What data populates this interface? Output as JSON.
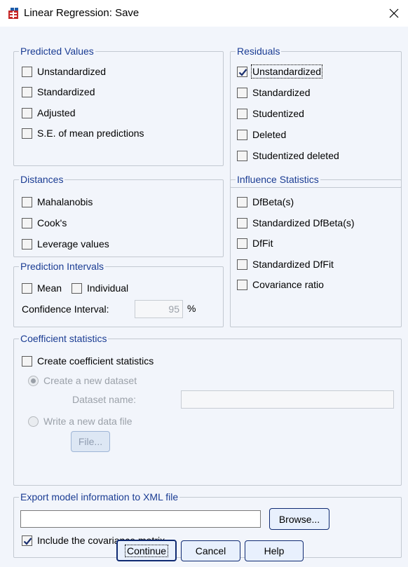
{
  "window": {
    "title": "Linear Regression: Save",
    "app_icon": "spss-dialog-icon",
    "close_icon": "close-icon"
  },
  "predicted_values": {
    "legend": "Predicted Values",
    "items": [
      {
        "label": "Unstandardized",
        "checked": false
      },
      {
        "label": "Standardized",
        "checked": false
      },
      {
        "label": "Adjusted",
        "checked": false
      },
      {
        "label": "S.E. of mean predictions",
        "checked": false
      }
    ]
  },
  "residuals": {
    "legend": "Residuals",
    "items": [
      {
        "label": "Unstandardized",
        "checked": true
      },
      {
        "label": "Standardized",
        "checked": false
      },
      {
        "label": "Studentized",
        "checked": false
      },
      {
        "label": "Deleted",
        "checked": false
      },
      {
        "label": "Studentized deleted",
        "checked": false
      }
    ]
  },
  "distances": {
    "legend": "Distances",
    "items": [
      {
        "label": "Mahalanobis",
        "checked": false
      },
      {
        "label": "Cook's",
        "checked": false
      },
      {
        "label": "Leverage values",
        "checked": false
      }
    ]
  },
  "influence": {
    "legend": "Influence Statistics",
    "items": [
      {
        "label": "DfBeta(s)",
        "checked": false
      },
      {
        "label": "Standardized DfBeta(s)",
        "checked": false
      },
      {
        "label": "DfFit",
        "checked": false
      },
      {
        "label": "Standardized DfFit",
        "checked": false
      },
      {
        "label": "Covariance ratio",
        "checked": false
      }
    ]
  },
  "prediction_intervals": {
    "legend": "Prediction Intervals",
    "mean_label": "Mean",
    "individual_label": "Individual",
    "confidence_label": "Confidence Interval:",
    "confidence_value": "95",
    "percent": "%"
  },
  "coefficient": {
    "legend": "Coefficient statistics",
    "create_label": "Create coefficient statistics",
    "new_dataset_label": "Create a new dataset",
    "dataset_name_label": "Dataset name:",
    "dataset_name_value": "",
    "write_file_label": "Write a new data file",
    "file_button": "File..."
  },
  "export": {
    "legend": "Export model information to XML file",
    "path_value": "",
    "browse_button": "Browse...",
    "include_cov_label": "Include the covariance matrix",
    "include_cov_checked": true
  },
  "buttons": {
    "continue": "Continue",
    "cancel": "Cancel",
    "help": "Help"
  },
  "colors": {
    "legend_text": "#1a3c93",
    "dialog_bg": "#f2f5fb",
    "button_border": "#0f2a72",
    "check_mark": "#1a2f6f"
  }
}
